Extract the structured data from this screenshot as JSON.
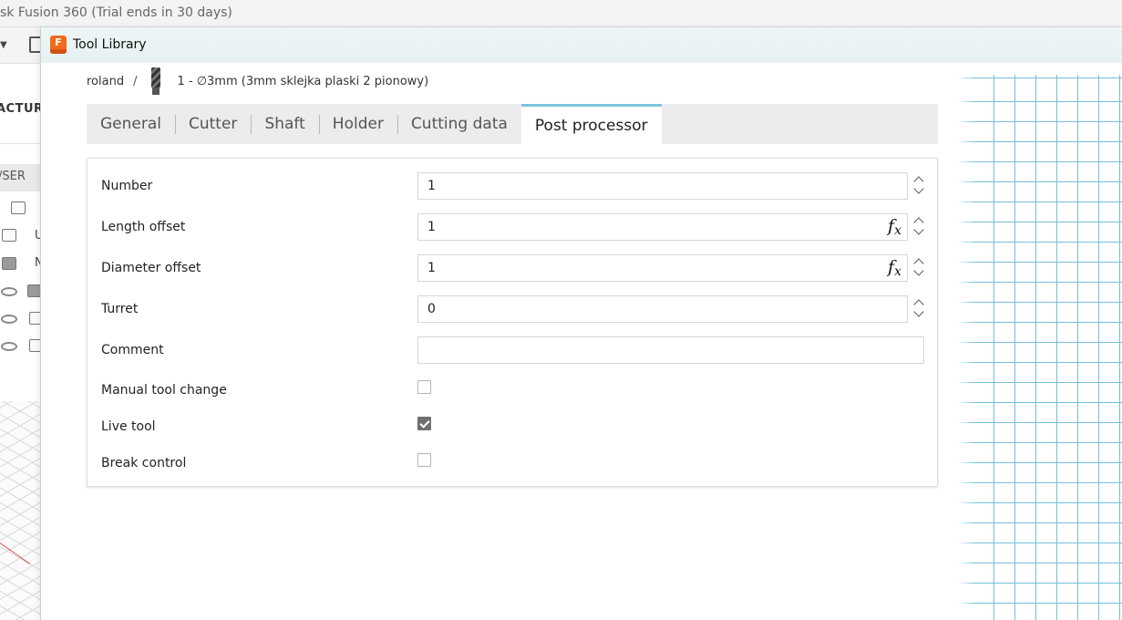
{
  "app": {
    "title": "sk Fusion 360 (Trial ends in 30 days)",
    "workspace_label": "ACTUR",
    "browser_label": "/SER",
    "tree_letters": [
      "U",
      "N"
    ]
  },
  "dialog": {
    "title": "Tool Library",
    "logo_letter": "F",
    "breadcrumb": {
      "root": "roland",
      "separator": "/",
      "tool": "1 - ∅3mm (3mm sklejka plaski 2 pionowy)"
    },
    "tabs": [
      {
        "label": "General",
        "active": false
      },
      {
        "label": "Cutter",
        "active": false
      },
      {
        "label": "Shaft",
        "active": false
      },
      {
        "label": "Holder",
        "active": false
      },
      {
        "label": "Cutting data",
        "active": false
      },
      {
        "label": "Post processor",
        "active": true
      }
    ],
    "form": {
      "number": {
        "label": "Number",
        "value": "1"
      },
      "length_offset": {
        "label": "Length offset",
        "value": "1",
        "fx": "f",
        "fx_sub": "x"
      },
      "diameter_offset": {
        "label": "Diameter offset",
        "value": "1",
        "fx": "f",
        "fx_sub": "x"
      },
      "turret": {
        "label": "Turret",
        "value": "0"
      },
      "comment": {
        "label": "Comment",
        "value": ""
      },
      "manual_tool_change": {
        "label": "Manual tool change",
        "checked": false
      },
      "live_tool": {
        "label": "Live tool",
        "checked": true
      },
      "break_control": {
        "label": "Break control",
        "checked": false
      }
    }
  },
  "colors": {
    "active_tab_accent": "#7cc3dc",
    "grid_line": "#5bb6d2",
    "logo": "#f26a1b"
  }
}
